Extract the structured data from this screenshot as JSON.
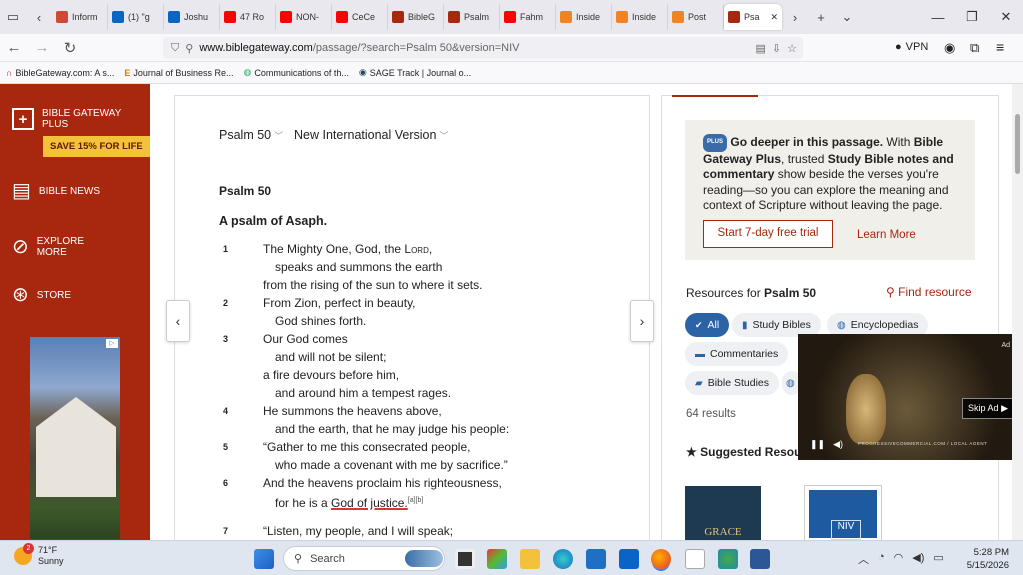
{
  "browser": {
    "tabs": [
      {
        "label": "Inform",
        "color": "#d14836"
      },
      {
        "label": "(1) \"g",
        "color": "#0a66c2"
      },
      {
        "label": "Joshu",
        "color": "#0a66c2"
      },
      {
        "label": "47 Ro",
        "color": "#ff0000"
      },
      {
        "label": "NON-",
        "color": "#ff0000"
      },
      {
        "label": "CeCe",
        "color": "#ff0000"
      },
      {
        "label": "BibleG",
        "color": "#a7280f"
      },
      {
        "label": "Psalm",
        "color": "#a7280f"
      },
      {
        "label": "Fahm",
        "color": "#ff0000"
      },
      {
        "label": "Inside",
        "color": "#f58220"
      },
      {
        "label": "Inside",
        "color": "#f58220"
      },
      {
        "label": "Post",
        "color": "#f58220"
      },
      {
        "label": "Psa",
        "color": "#a7280f"
      }
    ],
    "url_host": "www.biblegateway.com",
    "url_path": "/passage/?search=Psalm 50&version=NIV",
    "vpn_label": "VPN",
    "bookmarks": [
      "BibleGateway.com: A s...",
      "Journal of Business Re...",
      "Communications of th...",
      "SAGE Track | Journal o..."
    ]
  },
  "sidebar": {
    "plus_title": "BIBLE GATEWAY PLUS",
    "plus_badge": "SAVE 15% FOR LIFE",
    "news": "BIBLE NEWS",
    "explore": "EXPLORE MORE",
    "store": "STORE"
  },
  "passage": {
    "book_select": "Psalm 50",
    "version_select": "New International Version",
    "title": "Psalm 50",
    "subtitle": "A psalm of Asaph.",
    "verses": [
      {
        "n": "1",
        "lines": [
          "The Mighty One, God, the LORD,",
          "speaks and summons the earth",
          "from the rising of the sun to where it sets."
        ]
      },
      {
        "n": "2",
        "lines": [
          "From Zion, perfect in beauty,",
          "God shines forth."
        ]
      },
      {
        "n": "3",
        "lines": [
          "Our God comes",
          "and will not be silent;",
          "a fire devours before him,",
          "and around him a tempest rages."
        ]
      },
      {
        "n": "4",
        "lines": [
          "He summons the heavens above,",
          "and the earth, that he may judge his people:"
        ]
      },
      {
        "n": "5",
        "lines": [
          "“Gather to me this consecrated people,",
          "who made a covenant with me by sacrifice.”"
        ]
      },
      {
        "n": "6",
        "lines": [
          "And the heavens proclaim his righteousness,",
          "for he is a"
        ]
      },
      {
        "n": "7",
        "lines": [
          "“Listen, my people, and I will speak;"
        ]
      }
    ],
    "v1_prefix": "The Mighty One, God, the ",
    "v1_lord": "Lord",
    "v1_suffix": ",",
    "v6_underlined": "God of justice.",
    "v6_footnote": "[a][b]"
  },
  "promo": {
    "badge": "PLUS",
    "bold1": "Go deeper in this passage.",
    "text1": " With ",
    "bold2": "Bible Gateway Plus",
    "text2": ", trusted ",
    "bold3": "Study Bible notes and commentary",
    "text3": " show beside the verses you're reading—so you can explore the meaning and context of Scripture without leaving the page.",
    "trial_button": "Start 7-day free trial",
    "learn_more": "Learn More"
  },
  "resources": {
    "heading_prefix": "Resources for ",
    "heading_bold": "Psalm 50",
    "find": "Find resource",
    "chips": [
      "All",
      "Study Bibles",
      "Encyclopedias",
      "Commentaries",
      "Bible Studies"
    ],
    "results": "64 results",
    "suggested": "Suggested Resou"
  },
  "video_ad": {
    "skip": "Skip Ad ▶",
    "ad_label": "Ad",
    "caption": "PROGRESSIVECOMMERCIAL.COM / LOCAL AGENT"
  },
  "taskbar": {
    "temp": "71°F",
    "weather": "Sunny",
    "weather_badge": "2",
    "search": "Search",
    "time": "5:28 PM",
    "date": "5/15/2026"
  }
}
